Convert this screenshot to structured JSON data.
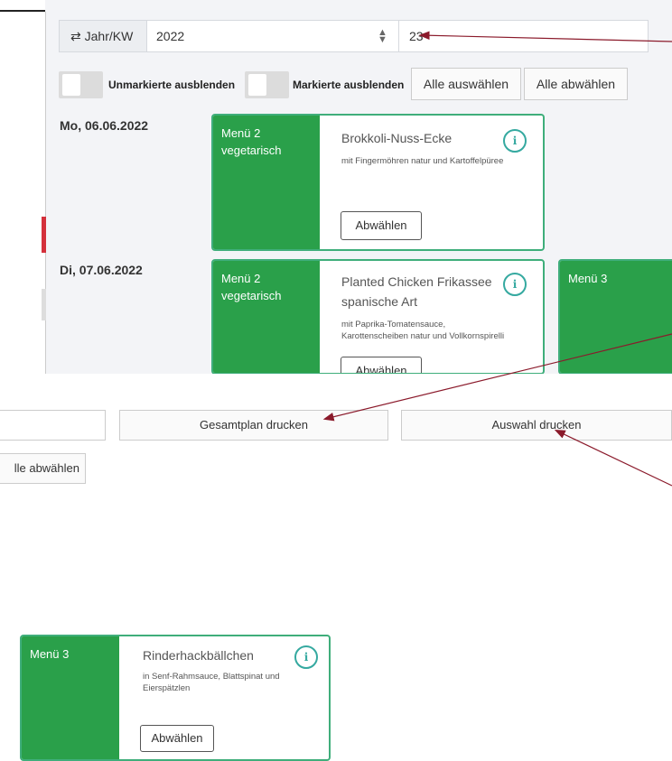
{
  "week_selector": {
    "label": "Jahr/KW",
    "year": "2022",
    "week": "23",
    "icon": "swap-arrows-icon"
  },
  "filters": {
    "hide_unmarked": "Unmarkierte ausblenden",
    "hide_marked": "Markierte ausblenden",
    "select_all": "Alle auswählen",
    "deselect_all": "Alle abwählen",
    "deselect_all_partial": "lle abwählen"
  },
  "days": [
    {
      "date": "Mo, 06.06.2022",
      "menus": [
        {
          "menu": "Menü 2",
          "category": "vegetarisch",
          "title_lines": [
            "Brokkoli-Nuss-Ecke"
          ],
          "desc_lines": [
            "mit Fingermöhren natur und Kartoffelpüree"
          ],
          "button": "Abwählen"
        }
      ]
    },
    {
      "date": "Di, 07.06.2022",
      "menus": [
        {
          "menu": "Menü 2",
          "category": "vegetarisch",
          "title_lines": [
            "Planted Chicken Frikassee",
            "spanische Art"
          ],
          "desc_lines": [
            "mit Paprika-Tomatensauce,",
            "Karottenscheiben natur und Vollkornspirelli"
          ],
          "button": "Abwählen"
        },
        {
          "menu": "Menü 3"
        }
      ]
    }
  ],
  "print": {
    "full_plan": "Gesamtplan drucken",
    "selection": "Auswahl drucken"
  },
  "extra_card": {
    "menu": "Menü 3",
    "title": "Rinderhackbällchen",
    "desc_lines": [
      "in Senf-Rahmsauce, Blattspinat und",
      "Eierspätzlen"
    ],
    "button": "Abwählen"
  },
  "colors": {
    "menu_green": "#2aa04a",
    "card_border": "#3fae7b",
    "info_teal": "#35a9a0",
    "annotation_arrow": "#8b1a2b",
    "marker_red": "#d4303b"
  },
  "icons": {
    "info": "info-icon",
    "swap": "swap-arrows-icon",
    "spinner": "spinner-arrows-icon"
  }
}
